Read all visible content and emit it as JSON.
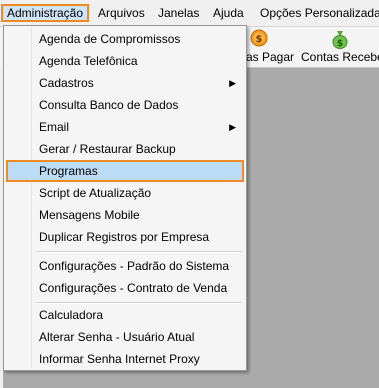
{
  "menubar": {
    "items": [
      {
        "label": "Administração"
      },
      {
        "label": "Arquivos"
      },
      {
        "label": "Janelas"
      },
      {
        "label": "Ajuda"
      },
      {
        "label": "Opções Personalizadas"
      }
    ]
  },
  "toolbar": {
    "items": [
      {
        "label": "as Pagar",
        "icon": "money-orange-icon"
      },
      {
        "label": "Contas Receber",
        "icon": "money-bag-green-icon"
      }
    ]
  },
  "dropdown": {
    "items": [
      {
        "label": "Agenda de Compromissos"
      },
      {
        "label": "Agenda Telefônica"
      },
      {
        "label": "Cadastros",
        "submenu": "▶"
      },
      {
        "label": "Consulta Banco de Dados"
      },
      {
        "label": "Email",
        "submenu": "▶"
      },
      {
        "label": "Gerar / Restaurar Backup"
      },
      {
        "label": "Programas"
      },
      {
        "label": "Script de Atualização"
      },
      {
        "label": "Mensagens Mobile"
      },
      {
        "label": "Duplicar Registros por Empresa"
      },
      {
        "label": "Configurações - Padrão do Sistema"
      },
      {
        "label": "Configurações - Contrato de Venda"
      },
      {
        "label": "Calculadora"
      },
      {
        "label": "Alterar Senha - Usuário Atual"
      },
      {
        "label": "Informar Senha Internet Proxy"
      }
    ]
  },
  "colors": {
    "highlight_border": "#f08a24",
    "selected_bg": "#bcdcf6",
    "workspace": "#aaaaaa"
  }
}
